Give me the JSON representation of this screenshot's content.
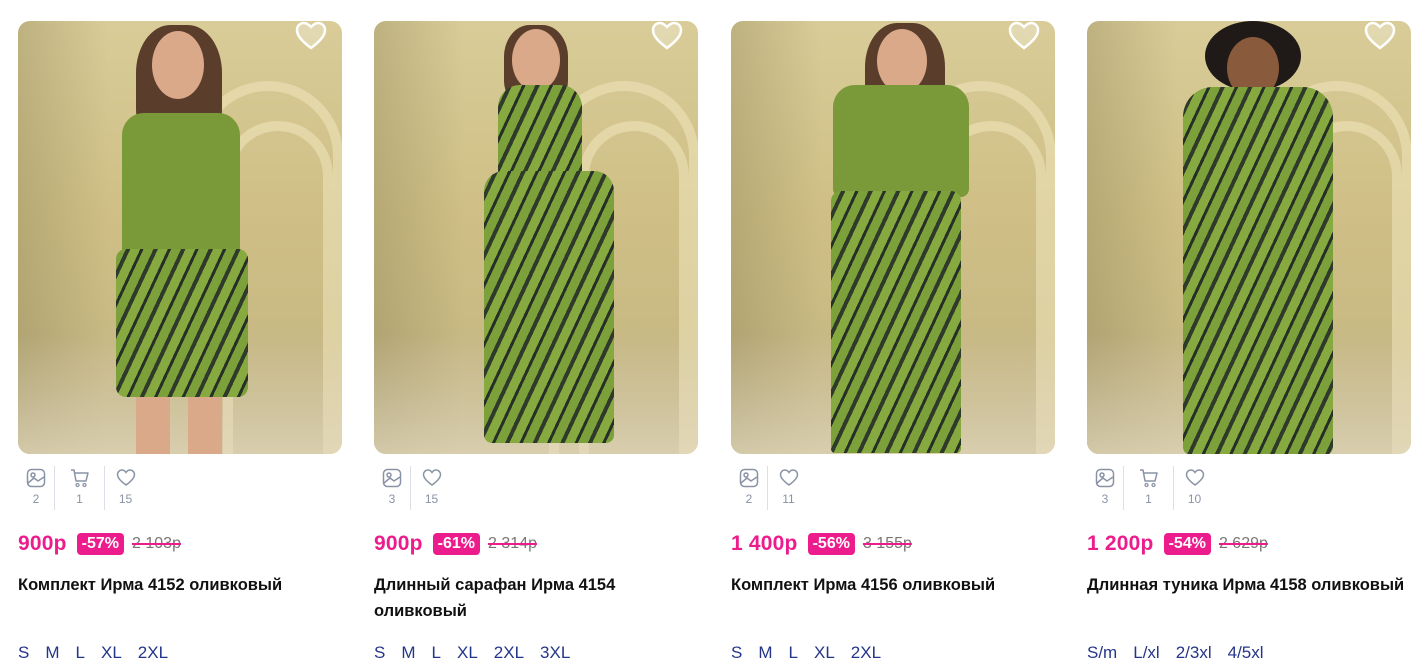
{
  "products": [
    {
      "stats": {
        "photos": "2",
        "cart": "1",
        "likes": "15"
      },
      "price": "900р",
      "discount": "-57%",
      "old_price": "2 103р",
      "title": "Комплект Ирма 4152 оливковый",
      "sizes": [
        "S",
        "M",
        "L",
        "XL",
        "2XL"
      ]
    },
    {
      "stats": {
        "photos": "3",
        "likes": "15"
      },
      "price": "900р",
      "discount": "-61%",
      "old_price": "2 314р",
      "title": "Длинный сарафан Ирма 4154 оливковый",
      "sizes": [
        "S",
        "M",
        "L",
        "XL",
        "2XL",
        "3XL"
      ]
    },
    {
      "stats": {
        "photos": "2",
        "likes": "11"
      },
      "price": "1 400р",
      "discount": "-56%",
      "old_price": "3 155р",
      "title": "Комплект Ирма 4156 оливковый",
      "sizes": [
        "S",
        "M",
        "L",
        "XL",
        "2XL"
      ]
    },
    {
      "stats": {
        "photos": "3",
        "cart": "1",
        "likes": "10"
      },
      "price": "1 200р",
      "discount": "-54%",
      "old_price": "2 629р",
      "title": "Длинная туника Ирма 4158 оливковый",
      "sizes": [
        "S/m",
        "L/xl",
        "2/3xl",
        "4/5xl"
      ]
    }
  ],
  "icons": {
    "favorite": "heart-outline-icon",
    "photos": "image-icon",
    "cart": "cart-icon",
    "likes": "heart-icon"
  },
  "colors": {
    "accent": "#ec1c8c",
    "size_link": "#24368a",
    "stat_gray": "#8a93a6"
  }
}
